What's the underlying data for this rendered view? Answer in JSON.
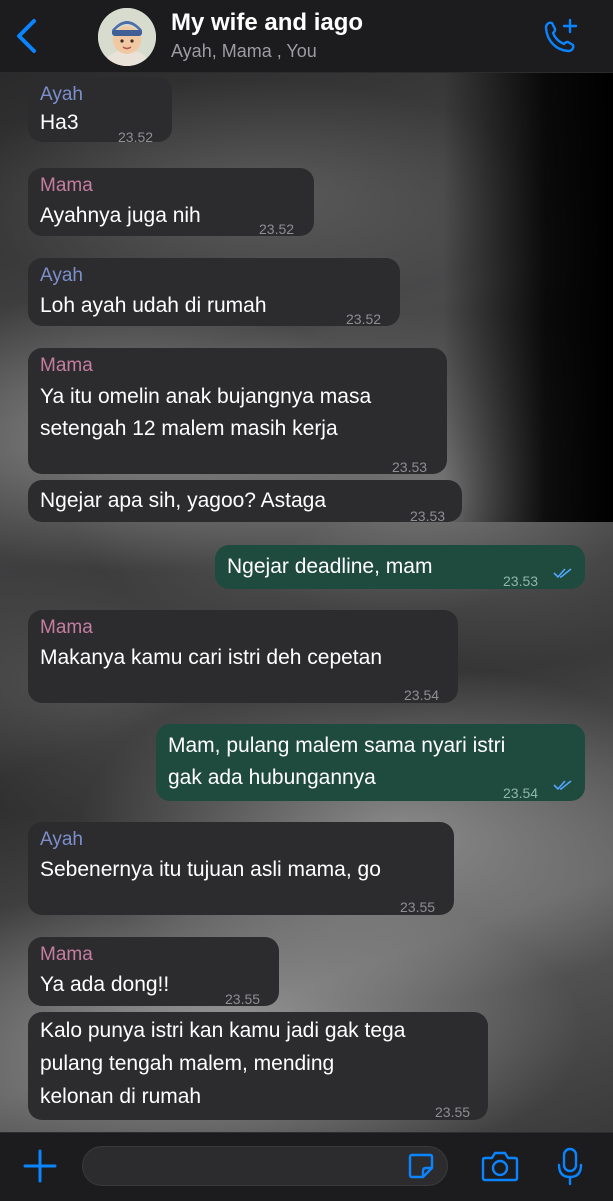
{
  "header": {
    "title": "My wife and iago",
    "subtitle": "Ayah, Mama , You",
    "accent": "#0a84ff"
  },
  "messages": [
    {
      "sender": "Ayah",
      "lines": [
        "Ha3"
      ],
      "time": "23.52",
      "direction": "in"
    },
    {
      "sender": "Mama",
      "lines": [
        "Ayahnya juga nih"
      ],
      "time": "23.52",
      "direction": "in"
    },
    {
      "sender": "Ayah",
      "lines": [
        "Loh ayah udah di rumah"
      ],
      "time": "23.52",
      "direction": "in"
    },
    {
      "sender": "Mama",
      "lines": [
        "Ya itu omelin anak bujangnya masa",
        "setengah 12 malem masih kerja"
      ],
      "time": "23.53",
      "direction": "in"
    },
    {
      "sender": "",
      "lines": [
        "Ngejar apa sih, yagoo? Astaga"
      ],
      "time": "23.53",
      "direction": "in"
    },
    {
      "sender": "",
      "lines": [
        "Ngejar deadline, mam"
      ],
      "time": "23.53",
      "direction": "out",
      "status": "read"
    },
    {
      "sender": "Mama",
      "lines": [
        "Makanya kamu cari istri deh cepetan"
      ],
      "time": "23.54",
      "direction": "in"
    },
    {
      "sender": "",
      "lines": [
        "Mam, pulang malem sama nyari istri",
        "gak ada hubungannya"
      ],
      "time": "23.54",
      "direction": "out",
      "status": "read"
    },
    {
      "sender": "Ayah",
      "lines": [
        "Sebenernya itu tujuan asli mama, go"
      ],
      "time": "23.55",
      "direction": "in"
    },
    {
      "sender": "Mama",
      "lines": [
        "Ya ada dong!!"
      ],
      "time": "23.55",
      "direction": "in"
    },
    {
      "sender": "",
      "lines": [
        "Kalo punya istri kan kamu jadi gak tega",
        "pulang tengah malem, mending",
        "kelonan di rumah"
      ],
      "time": "23.55",
      "direction": "in"
    }
  ],
  "composer": {
    "value": "",
    "placeholder": ""
  },
  "colors": {
    "incoming_bubble": "#2c2c2f",
    "outgoing_bubble": "#1f4a3e",
    "ayah_name": "#7c8fcc",
    "mama_name": "#c57ea1",
    "read_ticks": "#53a6ff"
  },
  "icons": [
    "back-chevron-icon",
    "avatar",
    "add-call-icon",
    "plus-icon",
    "sticker-icon",
    "camera-icon",
    "mic-icon"
  ]
}
